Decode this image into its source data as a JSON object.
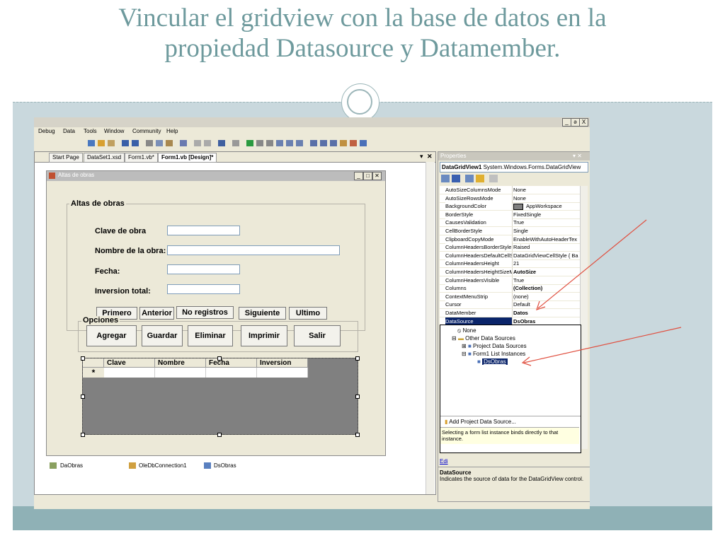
{
  "slide": {
    "title_line1": "Vincular el gridview con la base de datos en la",
    "title_line2": "propiedad Datasource y Datamember."
  },
  "window": {
    "controls": [
      "_",
      "ə",
      "X"
    ]
  },
  "menu": [
    "Debug",
    "Data",
    "Tools",
    "Window",
    "Community",
    "Help"
  ],
  "tabs": [
    "Start Page",
    "DataSet1.xsd",
    "Form1.vb*",
    "Form1.vb [Design]*"
  ],
  "form": {
    "title": "Altas de obras",
    "group_altas": "Altas de obras",
    "labels": {
      "clave": "Clave de obra",
      "nombre": "Nombre de la obra:",
      "fecha": "Fecha:",
      "inversion": "Inversion total:"
    },
    "nav_buttons": [
      "Primero",
      "Anterior",
      "No registros",
      "Siguiente",
      "Ultimo"
    ],
    "group_opciones": "Opciones",
    "option_buttons": [
      "Agregar",
      "Guardar",
      "Eliminar",
      "Imprimir",
      "Salir"
    ],
    "grid_columns": [
      "Clave",
      "Nombre",
      "Fecha",
      "Inversion"
    ],
    "grid_new_row_marker": "*"
  },
  "tray": [
    "DaObras",
    "OleDbConnection1",
    "DsObras"
  ],
  "properties": {
    "title": "Properties",
    "object_name": "DataGridView1",
    "object_type": "System.Windows.Forms.DataGridView",
    "rows": [
      {
        "name": "AutoSizeColumnsMode",
        "value": "None"
      },
      {
        "name": "AutoSizeRowsMode",
        "value": "None"
      },
      {
        "name": "BackgroundColor",
        "value": "AppWorkspace"
      },
      {
        "name": "BorderStyle",
        "value": "FixedSingle"
      },
      {
        "name": "CausesValidation",
        "value": "True"
      },
      {
        "name": "CellBorderStyle",
        "value": "Single"
      },
      {
        "name": "ClipboardCopyMode",
        "value": "EnableWithAutoHeaderTex"
      },
      {
        "name": "ColumnHeadersBorderStyle",
        "value": "Raised"
      },
      {
        "name": "ColumnHeadersDefaultCellStyle",
        "value": "DataGridViewCellStyle { Ba"
      },
      {
        "name": "ColumnHeadersHeight",
        "value": "21"
      },
      {
        "name": "ColumnHeadersHeightSizeMode",
        "value": "AutoSize"
      },
      {
        "name": "ColumnHeadersVisible",
        "value": "True"
      },
      {
        "name": "Columns",
        "value": "(Collection)"
      },
      {
        "name": "ContextMenuStrip",
        "value": "(none)"
      },
      {
        "name": "Cursor",
        "value": "Default"
      },
      {
        "name": "DataMember",
        "value": "Datos"
      },
      {
        "name": "DataSource",
        "value": "DsObras"
      }
    ],
    "dropdown": {
      "none": "None",
      "other": "Other Data Sources",
      "project": "Project Data Sources",
      "form_list": "Form1 List Instances",
      "selected": "DsObras",
      "add": "Add Project Data Source...",
      "hint": "Selecting a form list instance binds directly to that instance."
    },
    "help_title": "DataSource",
    "help_text": "Indicates the source of data for the DataGridView control.",
    "edit_link": "Edi"
  },
  "colors": {
    "title": "#6e9a9d",
    "arrow": "#e05040",
    "selection": "#0a246a"
  }
}
